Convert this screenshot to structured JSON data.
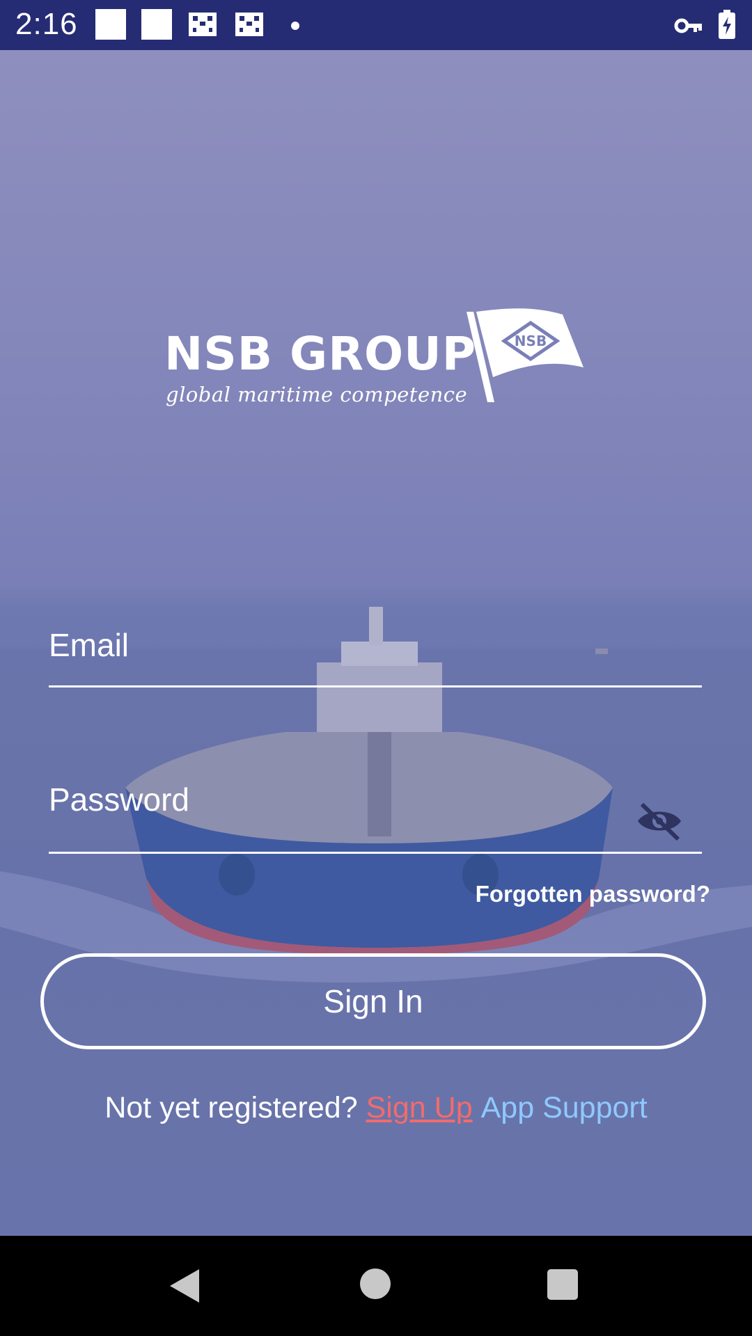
{
  "status_bar": {
    "time": "2:16",
    "icons": [
      "square-notification-icon",
      "square-notification-icon",
      "grid-notification-icon",
      "grid-notification-icon",
      "dot-icon",
      "vpn-key-icon",
      "battery-charging-icon"
    ]
  },
  "logo": {
    "name": "NSB GROUP",
    "tagline": "global maritime competence",
    "flag_text": "NSB"
  },
  "form": {
    "email_placeholder": "Email",
    "password_placeholder": "Password",
    "forgot_label": "Forgotten password?",
    "signin_label": "Sign In"
  },
  "footer": {
    "not_registered": "Not yet registered?",
    "signup_label": "Sign Up",
    "support_label": "App Support"
  },
  "colors": {
    "status_bar": "#262c73",
    "signup": "#f26b6b",
    "support": "#8ec9ff"
  }
}
